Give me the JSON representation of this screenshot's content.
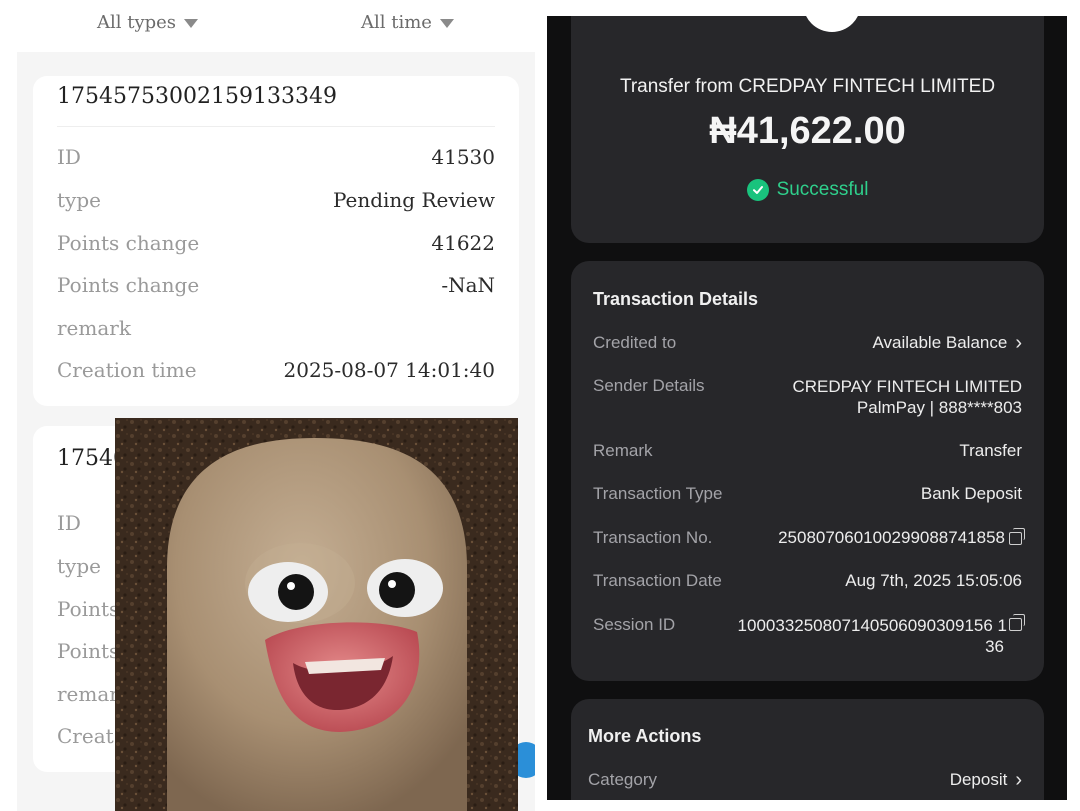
{
  "left": {
    "filters": {
      "types": "All types",
      "time": "All time"
    },
    "card1": {
      "order_no": "17545753002159133349",
      "rows": [
        {
          "label": "ID",
          "value": "41530"
        },
        {
          "label": "type",
          "value": "Pending Review"
        },
        {
          "label": "Points change",
          "value": "41622"
        },
        {
          "label": "Points change",
          "value": "-NaN"
        },
        {
          "label": "remark",
          "value": ""
        },
        {
          "label": "Creation time",
          "value": "2025-08-07 14:01:40"
        }
      ]
    },
    "card2": {
      "order_no_visible": "17540",
      "labels_visible": [
        "ID",
        "type",
        "Points",
        "Points",
        "remar",
        "Creat"
      ]
    }
  },
  "receipt": {
    "title": "Transfer from CREDPAY FINTECH LIMITED",
    "amount": "₦41,622.00",
    "status": "Successful",
    "colors": {
      "status": "#19c37d",
      "card": "#27272a",
      "background": "#0f0f10"
    },
    "details": {
      "heading": "Transaction Details",
      "credited_to_label": "Credited to",
      "credited_to_value": "Available Balance",
      "sender_label": "Sender Details",
      "sender_name": "CREDPAY FINTECH LIMITED",
      "sender_account": "PalmPay | 888****803",
      "remark_label": "Remark",
      "remark_value": "Transfer",
      "type_label": "Transaction Type",
      "type_value": "Bank Deposit",
      "txn_no_label": "Transaction No.",
      "txn_no_value": "250807060100299088741858",
      "date_label": "Transaction Date",
      "date_value": "Aug 7th, 2025 15:05:06",
      "session_label": "Session ID",
      "session_value_line1": "100033250807140506090309156 1",
      "session_value_line2": "36"
    },
    "more_actions": {
      "heading": "More Actions",
      "category_label": "Category",
      "category_value": "Deposit"
    },
    "icons": [
      "check-circle-icon",
      "chevron-right-icon",
      "copy-icon"
    ]
  }
}
